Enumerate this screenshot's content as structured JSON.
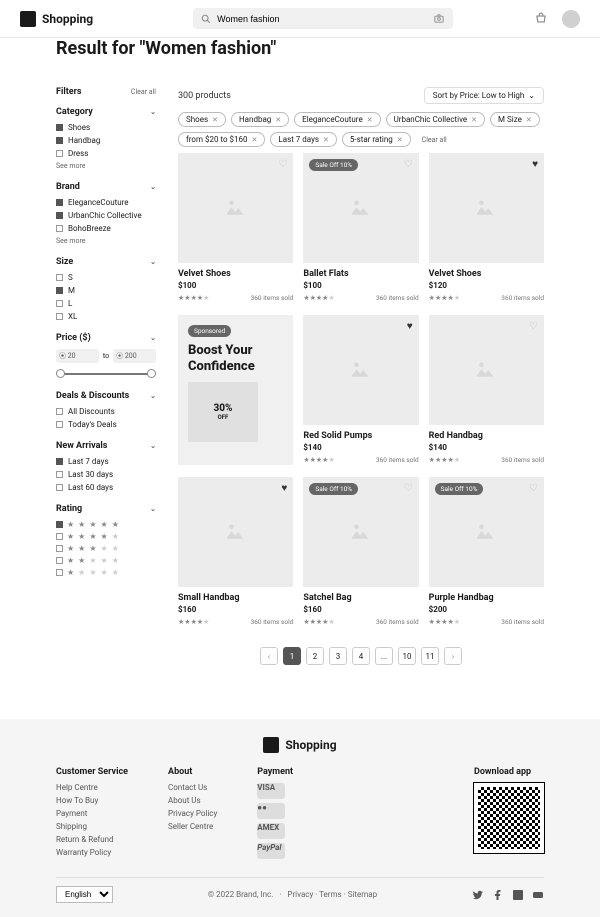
{
  "header": {
    "brand": "Shopping",
    "search_value": "Women fashion"
  },
  "page": {
    "title": "Result for \"Women fashion\"",
    "count": "300 products",
    "sort": "Sort by Price: Low to High"
  },
  "filters": {
    "title": "Filters",
    "clear": "Clear all",
    "seemore": "See more",
    "to": "to",
    "sections": {
      "category": {
        "label": "Category",
        "items": [
          {
            "label": "Shoes",
            "on": true
          },
          {
            "label": "Handbag",
            "on": true
          },
          {
            "label": "Dress",
            "on": false
          }
        ]
      },
      "brand": {
        "label": "Brand",
        "items": [
          {
            "label": "EleganceCouture",
            "on": true
          },
          {
            "label": "UrbanChic Collective",
            "on": true
          },
          {
            "label": "BohoBreeze",
            "on": false
          }
        ]
      },
      "size": {
        "label": "Size",
        "items": [
          {
            "label": "S",
            "on": false
          },
          {
            "label": "M",
            "on": true
          },
          {
            "label": "L",
            "on": false
          },
          {
            "label": "XL",
            "on": false
          }
        ]
      },
      "price": {
        "label": "Price ($)",
        "min": "20",
        "max": "200"
      },
      "deals": {
        "label": "Deals & Discounts",
        "items": [
          {
            "label": "All Discounts",
            "on": false
          },
          {
            "label": "Today's Deals",
            "on": false
          }
        ]
      },
      "arrivals": {
        "label": "New Arrivals",
        "items": [
          {
            "label": "Last 7 days",
            "on": true
          },
          {
            "label": "Last 30 days",
            "on": false
          },
          {
            "label": "Last 60 days",
            "on": false
          }
        ]
      },
      "rating": {
        "label": "Rating"
      }
    }
  },
  "chips": [
    "Shoes",
    "Handbag",
    "EleganceCouture",
    "UrbanChic Collective",
    "M Size",
    "from $20 to $160",
    "Last 7 days",
    "5-star rating"
  ],
  "chips_clear": "Clear all",
  "products": [
    {
      "name": "Velvet Shoes",
      "price": "$100",
      "rating": 4,
      "sold": "360 items sold",
      "fav": false
    },
    {
      "name": "Ballet Flats",
      "price": "$100",
      "rating": 4,
      "sold": "360 items sold",
      "badge": "Sale Off 10%",
      "fav": false
    },
    {
      "name": "Velvet Shoes",
      "price": "$120",
      "rating": 4,
      "sold": "360 items sold",
      "fav": true
    },
    {
      "promo": true,
      "badge": "Sponsored",
      "headline": "Boost Your Confidence",
      "discount": "30%",
      "off": "OFF"
    },
    {
      "name": "Red Solid Pumps",
      "price": "$140",
      "rating": 4,
      "sold": "360 items sold",
      "fav": true
    },
    {
      "name": "Red Handbag",
      "price": "$140",
      "rating": 4,
      "sold": "360 items sold",
      "fav": false
    },
    {
      "name": "Small Handbag",
      "price": "$160",
      "rating": 4,
      "sold": "360 items sold",
      "fav": true
    },
    {
      "name": "Satchel Bag",
      "price": "$160",
      "rating": 4,
      "sold": "360 items sold",
      "badge": "Sale Off 10%",
      "fav": false
    },
    {
      "name": "Purple Handbag",
      "price": "$200",
      "rating": 4,
      "sold": "360 items sold",
      "badge": "Sale Off 10%",
      "fav": false
    }
  ],
  "pagination": [
    "1",
    "2",
    "3",
    "4",
    "...",
    "10",
    "11"
  ],
  "footer": {
    "brand": "Shopping",
    "cs": {
      "title": "Customer Service",
      "links": [
        "Help Centre",
        "How To Buy",
        "Payment",
        "Shipping",
        "Return & Refund",
        "Warranty Policy"
      ]
    },
    "about": {
      "title": "About",
      "links": [
        "Contact Us",
        "About Us",
        "Privacy Policy",
        "Seller Centre"
      ]
    },
    "payment": {
      "title": "Payment"
    },
    "download": {
      "title": "Download app"
    },
    "lang": "English",
    "copy": "© 2022 Brand, Inc.",
    "links": [
      "Privacy",
      "Terms",
      "Sitemap"
    ]
  }
}
